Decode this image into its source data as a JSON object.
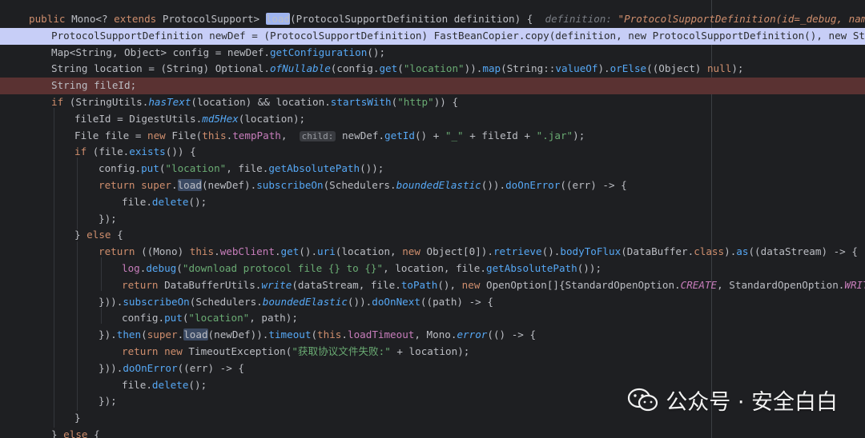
{
  "editor": {
    "lines": [
      {
        "bg": "",
        "indent": 36,
        "segs": [
          [
            "kw",
            "public "
          ],
          [
            "cls",
            "Mono<? "
          ],
          [
            "kw",
            "extends "
          ],
          [
            "cls",
            "ProtocolSupport> "
          ],
          [
            "match",
            "load"
          ],
          [
            "cls",
            "(ProtocolSupportDefinition definition) {  "
          ],
          [
            "hint-inline",
            "definition: "
          ],
          [
            "hint-val",
            "\"ProtocolSupportDefinition(id=_debug, name=ad"
          ]
        ]
      },
      {
        "bg": "hl-blue",
        "indent": 64,
        "segs": [
          [
            "cls",
            "ProtocolSupportDefinition newDef = (ProtocolSupportDefinition) FastBeanCopier.copy(definition, new ProtocolSupportDefinition(), new String"
          ]
        ]
      },
      {
        "bg": "",
        "indent": 64,
        "segs": [
          [
            "cls",
            "Map<String, Object> config = newDef."
          ],
          [
            "fn",
            "getConfiguration"
          ],
          [
            "cls",
            "();"
          ]
        ]
      },
      {
        "bg": "",
        "indent": 64,
        "segs": [
          [
            "cls",
            "String location = (String) Optional."
          ],
          [
            "sm",
            "ofNullable"
          ],
          [
            "cls",
            "(config."
          ],
          [
            "fn",
            "get"
          ],
          [
            "cls",
            "("
          ],
          [
            "str",
            "\"location\""
          ],
          [
            "cls",
            "))."
          ],
          [
            "fn",
            "map"
          ],
          [
            "cls",
            "(String::"
          ],
          [
            "fn",
            "valueOf"
          ],
          [
            "cls",
            ")."
          ],
          [
            "fn",
            "orElse"
          ],
          [
            "cls",
            "((Object) "
          ],
          [
            "kw",
            "null"
          ],
          [
            "cls",
            ");"
          ]
        ]
      },
      {
        "bg": "hl-red",
        "indent": 64,
        "segs": [
          [
            "cls",
            "String fileId;"
          ]
        ]
      },
      {
        "bg": "",
        "indent": 64,
        "segs": [
          [
            "kw",
            "if "
          ],
          [
            "cls",
            "(StringUtils."
          ],
          [
            "sm",
            "hasText"
          ],
          [
            "cls",
            "(location) && location."
          ],
          [
            "fn",
            "startsWith"
          ],
          [
            "cls",
            "("
          ],
          [
            "str",
            "\"http\""
          ],
          [
            "cls",
            ")) {"
          ]
        ]
      },
      {
        "bg": "",
        "indent": 93,
        "segs": [
          [
            "cls",
            "fileId = DigestUtils."
          ],
          [
            "sm",
            "md5Hex"
          ],
          [
            "cls",
            "(location);"
          ]
        ]
      },
      {
        "bg": "",
        "indent": 93,
        "segs": [
          [
            "cls",
            "File file = "
          ],
          [
            "kw",
            "new "
          ],
          [
            "cls",
            "File("
          ],
          [
            "kw",
            "this"
          ],
          [
            "cls",
            "."
          ],
          [
            "fld",
            "tempPath"
          ],
          [
            "cls",
            ",  "
          ],
          [
            "chip",
            "child:"
          ],
          [
            "cls",
            " newDef."
          ],
          [
            "fn",
            "getId"
          ],
          [
            "cls",
            "() + "
          ],
          [
            "str",
            "\"_\""
          ],
          [
            "cls",
            " + fileId + "
          ],
          [
            "str",
            "\".jar\""
          ],
          [
            "cls",
            ");"
          ]
        ]
      },
      {
        "bg": "",
        "indent": 93,
        "segs": [
          [
            "kw",
            "if "
          ],
          [
            "cls",
            "(file."
          ],
          [
            "fn",
            "exists"
          ],
          [
            "cls",
            "()) {"
          ]
        ]
      },
      {
        "bg": "",
        "indent": 123,
        "segs": [
          [
            "cls",
            "config."
          ],
          [
            "fn",
            "put"
          ],
          [
            "cls",
            "("
          ],
          [
            "str",
            "\"location\""
          ],
          [
            "cls",
            ", file."
          ],
          [
            "fn",
            "getAbsolutePath"
          ],
          [
            "cls",
            "());"
          ]
        ]
      },
      {
        "bg": "",
        "indent": 123,
        "segs": [
          [
            "kw",
            "return super"
          ],
          [
            "cls",
            "."
          ],
          [
            "match",
            "load"
          ],
          [
            "cls",
            "(newDef)."
          ],
          [
            "fn",
            "subscribeOn"
          ],
          [
            "cls",
            "(Schedulers."
          ],
          [
            "sm",
            "boundedElastic"
          ],
          [
            "cls",
            "())."
          ],
          [
            "fn",
            "doOnError"
          ],
          [
            "cls",
            "((err) -> {"
          ]
        ]
      },
      {
        "bg": "",
        "indent": 152,
        "segs": [
          [
            "cls",
            "file."
          ],
          [
            "fn",
            "delete"
          ],
          [
            "cls",
            "();"
          ]
        ]
      },
      {
        "bg": "",
        "indent": 123,
        "segs": [
          [
            "cls",
            "});"
          ]
        ]
      },
      {
        "bg": "",
        "indent": 93,
        "segs": [
          [
            "cls",
            "} "
          ],
          [
            "kw",
            "else "
          ],
          [
            "cls",
            "{"
          ]
        ]
      },
      {
        "bg": "",
        "indent": 123,
        "segs": [
          [
            "kw",
            "return "
          ],
          [
            "cls",
            "((Mono) "
          ],
          [
            "kw",
            "this"
          ],
          [
            "cls",
            "."
          ],
          [
            "fld",
            "webClient"
          ],
          [
            "cls",
            "."
          ],
          [
            "fn",
            "get"
          ],
          [
            "cls",
            "()."
          ],
          [
            "fn",
            "uri"
          ],
          [
            "cls",
            "(location, "
          ],
          [
            "kw",
            "new "
          ],
          [
            "cls",
            "Object[0])."
          ],
          [
            "fn",
            "retrieve"
          ],
          [
            "cls",
            "()."
          ],
          [
            "fn",
            "bodyToFlux"
          ],
          [
            "cls",
            "(DataBuffer."
          ],
          [
            "kw",
            "class"
          ],
          [
            "cls",
            ")."
          ],
          [
            "fn",
            "as"
          ],
          [
            "cls",
            "((dataStream) -> {"
          ]
        ]
      },
      {
        "bg": "",
        "indent": 152,
        "segs": [
          [
            "fld",
            "log"
          ],
          [
            "cls",
            "."
          ],
          [
            "fn",
            "debug"
          ],
          [
            "cls",
            "("
          ],
          [
            "str",
            "\"download protocol file {} to {}\""
          ],
          [
            "cls",
            ", location, file."
          ],
          [
            "fn",
            "getAbsolutePath"
          ],
          [
            "cls",
            "());"
          ]
        ]
      },
      {
        "bg": "",
        "indent": 152,
        "segs": [
          [
            "kw",
            "return "
          ],
          [
            "cls",
            "DataBufferUtils."
          ],
          [
            "sm",
            "write"
          ],
          [
            "cls",
            "(dataStream, file."
          ],
          [
            "fn",
            "toPath"
          ],
          [
            "cls",
            "(), "
          ],
          [
            "kw",
            "new "
          ],
          [
            "cls",
            "OpenOption[]{StandardOpenOption."
          ],
          [
            "cst",
            "CREATE"
          ],
          [
            "cls",
            ", StandardOpenOption."
          ],
          [
            "cst",
            "WRITE"
          ],
          [
            "cls",
            "})"
          ]
        ]
      },
      {
        "bg": "",
        "indent": 123,
        "segs": [
          [
            "cls",
            "}))."
          ],
          [
            "fn",
            "subscribeOn"
          ],
          [
            "cls",
            "(Schedulers."
          ],
          [
            "sm",
            "boundedElastic"
          ],
          [
            "cls",
            "())."
          ],
          [
            "fn",
            "doOnNext"
          ],
          [
            "cls",
            "((path) -> {"
          ]
        ]
      },
      {
        "bg": "",
        "indent": 152,
        "segs": [
          [
            "cls",
            "config."
          ],
          [
            "fn",
            "put"
          ],
          [
            "cls",
            "("
          ],
          [
            "str",
            "\"location\""
          ],
          [
            "cls",
            ", path);"
          ]
        ]
      },
      {
        "bg": "",
        "indent": 123,
        "segs": [
          [
            "cls",
            "})."
          ],
          [
            "fn",
            "then"
          ],
          [
            "cls",
            "("
          ],
          [
            "kw",
            "super"
          ],
          [
            "cls",
            "."
          ],
          [
            "match",
            "load"
          ],
          [
            "cls",
            "(newDef))."
          ],
          [
            "fn",
            "timeout"
          ],
          [
            "cls",
            "("
          ],
          [
            "kw",
            "this"
          ],
          [
            "cls",
            "."
          ],
          [
            "fld",
            "loadTimeout"
          ],
          [
            "cls",
            ", Mono."
          ],
          [
            "sm",
            "error"
          ],
          [
            "cls",
            "(() -> {"
          ]
        ]
      },
      {
        "bg": "",
        "indent": 152,
        "segs": [
          [
            "kw",
            "return new "
          ],
          [
            "cls",
            "TimeoutException("
          ],
          [
            "str",
            "\"获取协议文件失败:\""
          ],
          [
            "cls",
            " + location);"
          ]
        ]
      },
      {
        "bg": "",
        "indent": 123,
        "segs": [
          [
            "cls",
            "}))."
          ],
          [
            "fn",
            "doOnError"
          ],
          [
            "cls",
            "((err) -> {"
          ]
        ]
      },
      {
        "bg": "",
        "indent": 152,
        "segs": [
          [
            "cls",
            "file."
          ],
          [
            "fn",
            "delete"
          ],
          [
            "cls",
            "();"
          ]
        ]
      },
      {
        "bg": "",
        "indent": 123,
        "segs": [
          [
            "cls",
            "});"
          ]
        ]
      },
      {
        "bg": "",
        "indent": 93,
        "segs": [
          [
            "cls",
            "}"
          ]
        ]
      },
      {
        "bg": "",
        "indent": 64,
        "segs": [
          [
            "cls",
            "} "
          ],
          [
            "kw",
            "else "
          ],
          [
            "cls",
            "{"
          ]
        ]
      }
    ]
  },
  "watermark": {
    "icon": "wechat-icon",
    "text": "公众号 · 安全白白"
  }
}
